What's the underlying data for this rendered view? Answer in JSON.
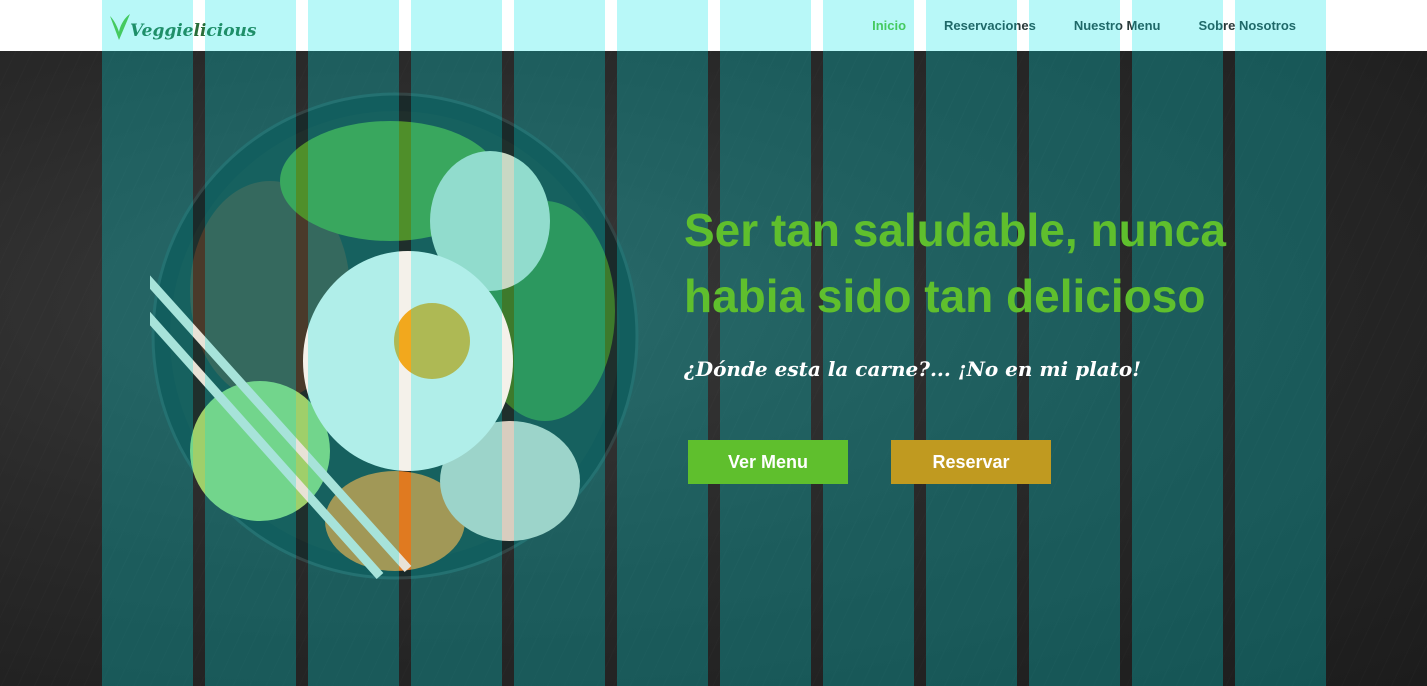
{
  "brand": {
    "name": "Veggielicious"
  },
  "nav": {
    "items": [
      {
        "label": "Inicio",
        "active": true
      },
      {
        "label": "Reservaciones",
        "active": false
      },
      {
        "label": "Nuestro Menu",
        "active": false
      },
      {
        "label": "Sobre Nosotros",
        "active": false
      }
    ]
  },
  "hero": {
    "headline": "Ser tan saludable, nunca habia sido tan delicioso",
    "tagline": "¿Dónde esta la carne?... ¡No en mi plato!",
    "menu_button": "Ver Menu",
    "reserve_button": "Reservar"
  },
  "colors": {
    "accent_green": "#5fbf2d",
    "accent_gold": "#c09a20",
    "grid_overlay": "#00e6e6"
  }
}
